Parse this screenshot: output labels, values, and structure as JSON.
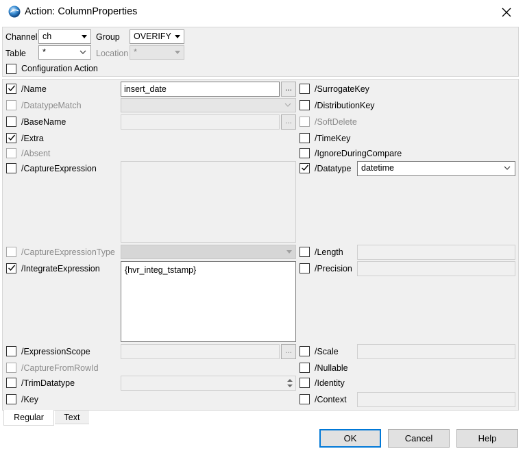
{
  "window": {
    "title": "Action: ColumnProperties"
  },
  "top": {
    "channel_label": "Channel",
    "channel_value": "ch",
    "group_label": "Group",
    "group_value": "OVERIFY",
    "table_label": "Table",
    "table_value": "*",
    "location_label": "Location",
    "location_value": "*",
    "config_label": "Configuration Action"
  },
  "params": {
    "name": {
      "label": "/Name",
      "value": "insert_date",
      "ellipsis": "..."
    },
    "datatypematch": {
      "label": "/DatatypeMatch"
    },
    "basename": {
      "label": "/BaseName",
      "ellipsis": "..."
    },
    "extra": {
      "label": "/Extra"
    },
    "absent": {
      "label": "/Absent"
    },
    "captureexpression": {
      "label": "/CaptureExpression"
    },
    "captureexpressiontype": {
      "label": "/CaptureExpressionType"
    },
    "integrateexpression": {
      "label": "/IntegrateExpression",
      "value": "{hvr_integ_tstamp}"
    },
    "expressionscope": {
      "label": "/ExpressionScope",
      "ellipsis": "..."
    },
    "capturefromrowid": {
      "label": "/CaptureFromRowId"
    },
    "trimdatatype": {
      "label": "/TrimDatatype"
    },
    "key": {
      "label": "/Key"
    },
    "surrogatekey": {
      "label": "/SurrogateKey"
    },
    "distributionkey": {
      "label": "/DistributionKey"
    },
    "softdelete": {
      "label": "/SoftDelete"
    },
    "timekey": {
      "label": "/TimeKey"
    },
    "ignoreduringcompare": {
      "label": "/IgnoreDuringCompare"
    },
    "datatype": {
      "label": "/Datatype",
      "value": "datetime"
    },
    "length": {
      "label": "/Length"
    },
    "precision": {
      "label": "/Precision"
    },
    "scale": {
      "label": "/Scale"
    },
    "nullable": {
      "label": "/Nullable"
    },
    "identity": {
      "label": "/Identity"
    },
    "context": {
      "label": "/Context"
    }
  },
  "tabs": [
    {
      "label": "Regular"
    },
    {
      "label": "Text"
    }
  ],
  "buttons": {
    "ok": "OK",
    "cancel": "Cancel",
    "help": "Help"
  },
  "colors": {
    "accent": "#0078d7",
    "panel_bg": "#f0f0f0"
  }
}
